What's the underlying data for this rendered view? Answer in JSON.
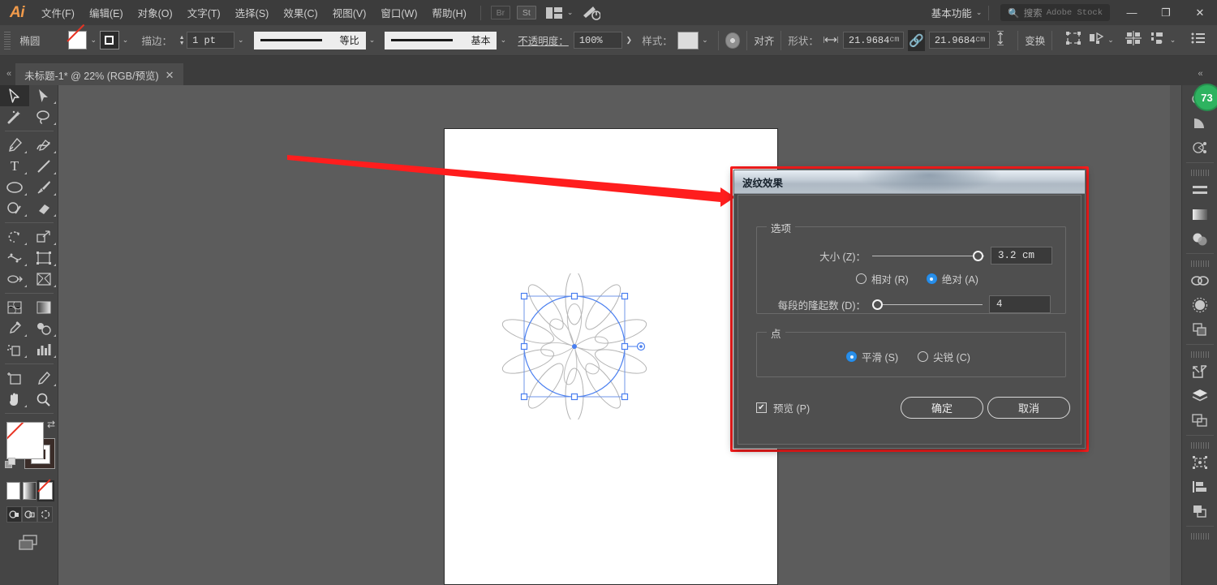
{
  "app": {
    "name": "Ai"
  },
  "menubar": {
    "items": [
      {
        "label": "文件(F)"
      },
      {
        "label": "编辑(E)"
      },
      {
        "label": "对象(O)"
      },
      {
        "label": "文字(T)"
      },
      {
        "label": "选择(S)"
      },
      {
        "label": "效果(C)"
      },
      {
        "label": "视图(V)"
      },
      {
        "label": "窗口(W)"
      },
      {
        "label": "帮助(H)"
      }
    ],
    "bridge_button": "Br",
    "stock_button": "St",
    "workspace": "基本功能",
    "search_placeholder": "搜索",
    "search_suffix": "Adobe Stock",
    "window_minimize": "—",
    "window_restore": "❐",
    "window_close": "✕"
  },
  "optionsbar": {
    "shape_label": "椭圆",
    "fill_swatch": "none-swatch",
    "stroke_swatch": "stroke-swatch",
    "stroke_label": "描边：",
    "stroke_weight": "1 pt",
    "profile_label": "等比",
    "brush_label": "基本",
    "opacity_label": "不透明度：",
    "opacity_value": "100%",
    "style_label": "样式：",
    "align_label": "对齐",
    "shape_group_label": "形状：",
    "width_value": "21.9684",
    "width_unit": "cm",
    "height_value": "21.9684",
    "height_unit": "cm",
    "transform_label": "变换",
    "link_state": "linked"
  },
  "tabbar": {
    "document_tab": "未标题-1* @ 22% (RGB/预览)",
    "close_glyph": "✕"
  },
  "toolbar": {
    "tools": [
      {
        "name": "selection-tool",
        "selected": true
      },
      {
        "name": "direct-selection-tool",
        "selected": false
      },
      {
        "name": "magic-wand-tool",
        "selected": false
      },
      {
        "name": "lasso-tool",
        "selected": false
      },
      {
        "name": "pen-tool",
        "selected": false
      },
      {
        "name": "curvature-tool",
        "selected": false
      },
      {
        "name": "type-tool",
        "selected": false
      },
      {
        "name": "line-segment-tool",
        "selected": false
      },
      {
        "name": "ellipse-tool",
        "selected": false
      },
      {
        "name": "paintbrush-tool",
        "selected": false
      },
      {
        "name": "shaper-tool",
        "selected": false
      },
      {
        "name": "eraser-tool",
        "selected": false
      },
      {
        "name": "rotate-tool",
        "selected": false
      },
      {
        "name": "scale-tool",
        "selected": false
      },
      {
        "name": "width-tool",
        "selected": false
      },
      {
        "name": "free-transform-tool",
        "selected": false
      },
      {
        "name": "shape-builder-tool",
        "selected": false
      },
      {
        "name": "perspective-grid-tool",
        "selected": false
      },
      {
        "name": "mesh-tool",
        "selected": false
      },
      {
        "name": "gradient-tool",
        "selected": false
      },
      {
        "name": "eyedropper-tool",
        "selected": false
      },
      {
        "name": "blend-tool",
        "selected": false
      },
      {
        "name": "symbol-sprayer-tool",
        "selected": false
      },
      {
        "name": "column-graph-tool",
        "selected": false
      },
      {
        "name": "artboard-tool",
        "selected": false
      },
      {
        "name": "slice-tool",
        "selected": false
      },
      {
        "name": "hand-tool",
        "selected": false
      },
      {
        "name": "zoom-tool",
        "selected": false
      }
    ],
    "fill_state": "none",
    "stroke_state": "black",
    "color_modes": [
      "color",
      "gradient",
      "none"
    ],
    "draw_modes": [
      "draw-normal",
      "draw-behind",
      "draw-inside"
    ]
  },
  "right_dock": {
    "cc_badge": "73",
    "panels": [
      "color-guide-icon",
      "gradient-wedge-icon",
      "shape-node-icon",
      "align-lines-icon",
      "gradient-panel-icon",
      "transparency-icon",
      "creative-cloud-icon",
      "symbols-icon",
      "layers-stack-icon",
      "export-icon",
      "layers-icon",
      "artboards-icon",
      "transform-icon",
      "align-panel-icon",
      "pathfinder-icon"
    ]
  },
  "dialog": {
    "title": "波纹效果",
    "options_group_label": "选项",
    "size_label": "大小 (Z)：",
    "size_value": "3.2 cm",
    "size_slider_percent": 96,
    "relative_label": "相对 (R)",
    "relative_selected": false,
    "absolute_label": "绝对 (A)",
    "absolute_selected": true,
    "ridges_label": "每段的隆起数 (D)：",
    "ridges_value": "4",
    "ridges_slider_percent": 2,
    "points_group_label": "点",
    "smooth_label": "平滑 (S)",
    "smooth_selected": true,
    "corner_label": "尖锐 (C)",
    "corner_selected": false,
    "preview_label": "预览 (P)",
    "preview_checked": true,
    "ok_label": "确定",
    "cancel_label": "取消",
    "highlight_color": "#ff1d1d"
  },
  "canvas": {
    "zoom": "22%",
    "selection_color": "#4a7ff0",
    "annotation_arrow_color": "#ff1d1d"
  }
}
